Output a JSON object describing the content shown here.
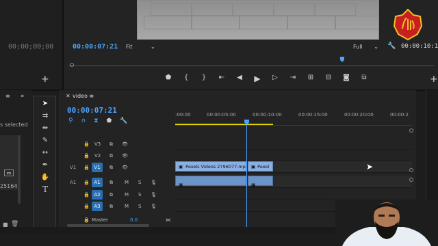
{
  "source_monitor": {
    "timecode": "00;00;00;00"
  },
  "program_monitor": {
    "timecode": "00:00:07:21",
    "fit_label": "Fit",
    "quality_label": "Full",
    "end_timecode": "00:00:10:19"
  },
  "left_panel": {
    "selected_text": "s selected",
    "count_text": "25164"
  },
  "timeline": {
    "title": "video",
    "timecode": "00:00:07:21",
    "ruler": [
      ":00:00",
      "00:00:05:00",
      "00:00:10:00",
      "00:00:15:00",
      "00:00:20:00",
      "00:00:2"
    ],
    "tracks": [
      {
        "src": "",
        "label": "V3"
      },
      {
        "src": "",
        "label": "V2"
      },
      {
        "src": "V1",
        "label": "V1"
      },
      {
        "src": "A1",
        "label": "A1"
      },
      {
        "src": "",
        "label": "A2"
      },
      {
        "src": "",
        "label": "A3"
      }
    ],
    "mute_label": "M",
    "solo_label": "S",
    "master_label": "Master",
    "master_value": "0.0",
    "clips": {
      "video_clip_1": "Pexels Videos 2796077.mp",
      "video_clip_2": "Pexel"
    }
  },
  "colors": {
    "accent": "#4aa3ff",
    "clip_video": "#8ab0e3",
    "clip_audio": "#6d94c6"
  }
}
